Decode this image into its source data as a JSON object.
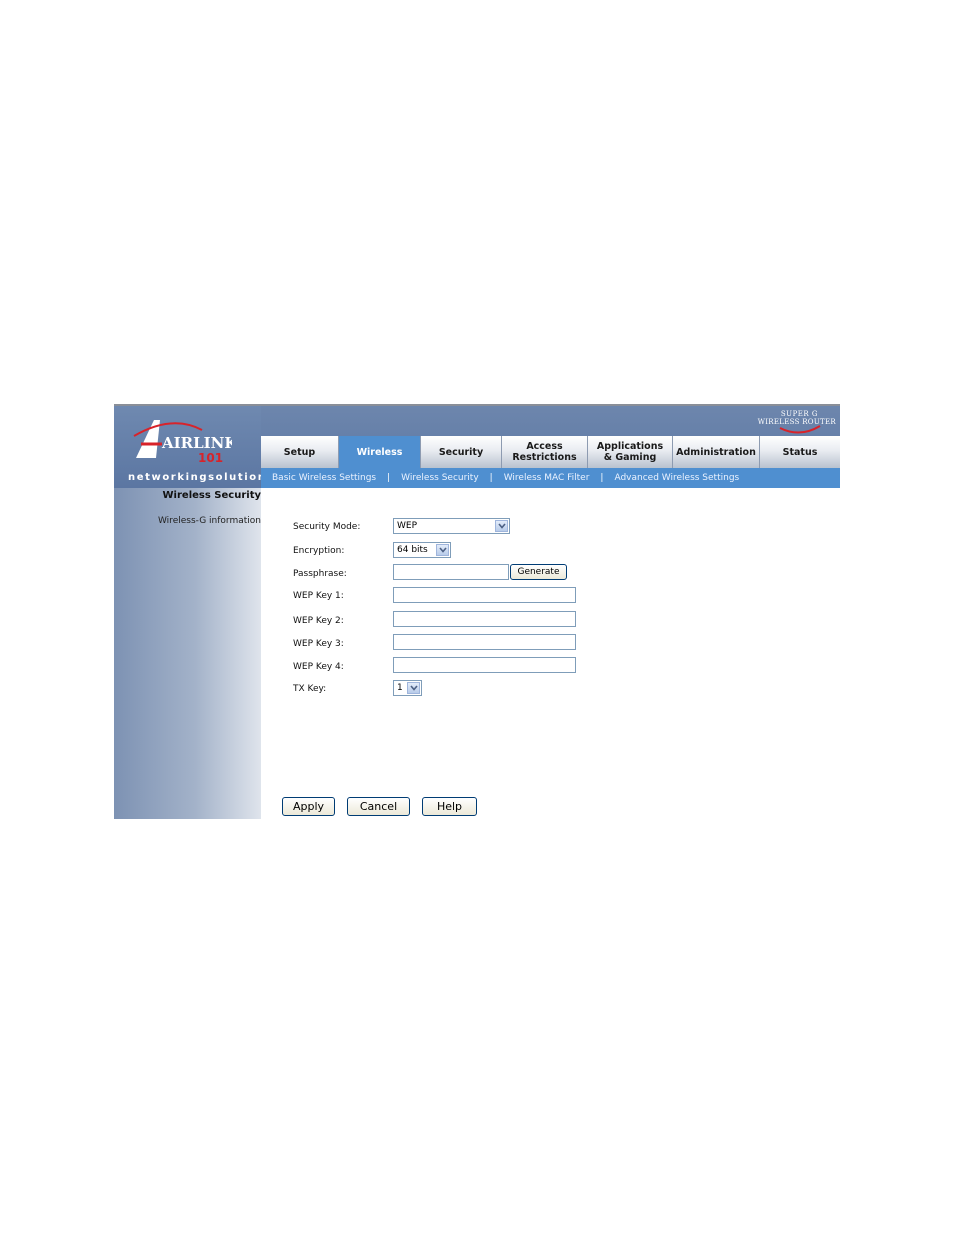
{
  "brand": {
    "logo_text": "AIRLINK",
    "logo_number": "101",
    "tagline": "networkingsolutions",
    "badge_line1": "SUPER G",
    "badge_line2": "WIRELESS ROUTER"
  },
  "tabs": [
    {
      "label": "Setup"
    },
    {
      "label": "Wireless"
    },
    {
      "label": "Security"
    },
    {
      "label": "Access Restrictions"
    },
    {
      "label": "Applications & Gaming"
    },
    {
      "label": "Administration"
    },
    {
      "label": "Status"
    }
  ],
  "subnav": [
    {
      "label": "Basic Wireless Settings"
    },
    {
      "label": "Wireless Security"
    },
    {
      "label": "Wireless MAC Filter"
    },
    {
      "label": "Advanced Wireless Settings"
    }
  ],
  "sidebar": {
    "title": "Wireless Security",
    "subtitle": "Wireless-G information"
  },
  "form": {
    "security_mode_label": "Security Mode:",
    "security_mode_value": "WEP",
    "encryption_label": "Encryption:",
    "encryption_value": "64 bits",
    "passphrase_label": "Passphrase:",
    "passphrase_value": "",
    "generate_label": "Generate",
    "wep_key1_label": "WEP Key 1:",
    "wep_key2_label": "WEP Key 2:",
    "wep_key3_label": "WEP Key 3:",
    "wep_key4_label": "WEP Key 4:",
    "tx_key_label": "TX Key:",
    "tx_key_value": "1"
  },
  "actions": {
    "apply_label": "Apply",
    "cancel_label": "Cancel",
    "help_label": "Help"
  },
  "colors": {
    "header": "#5b76a2",
    "accent": "#4f8fd0"
  }
}
